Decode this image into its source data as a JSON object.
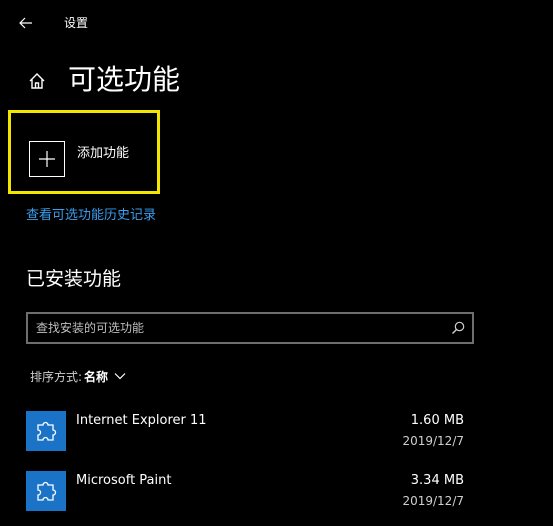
{
  "window": {
    "title": "设置",
    "back_icon": "arrow-left-icon"
  },
  "header": {
    "home_icon": "home-icon",
    "title": "可选功能"
  },
  "add_feature": {
    "icon": "plus-icon",
    "label": "添加功能",
    "highlight_color": "#f2e600"
  },
  "history_link": {
    "label": "查看可选功能历史记录",
    "color": "#3a9ded"
  },
  "installed": {
    "title": "已安装功能",
    "search": {
      "placeholder": "查找安装的可选功能",
      "value": "",
      "icon": "search-icon"
    },
    "sort": {
      "label": "排序方式:",
      "value": "名称",
      "icon": "chevron-down-icon"
    },
    "features": [
      {
        "name": "Internet Explorer 11",
        "size": "1.60 MB",
        "date": "2019/12/7",
        "icon": "puzzle-piece-icon"
      },
      {
        "name": "Microsoft Paint",
        "size": "3.34 MB",
        "date": "2019/12/7",
        "icon": "puzzle-piece-icon"
      }
    ]
  },
  "colors": {
    "background": "#000000",
    "accent": "#1a73c6",
    "text": "#ffffff"
  }
}
